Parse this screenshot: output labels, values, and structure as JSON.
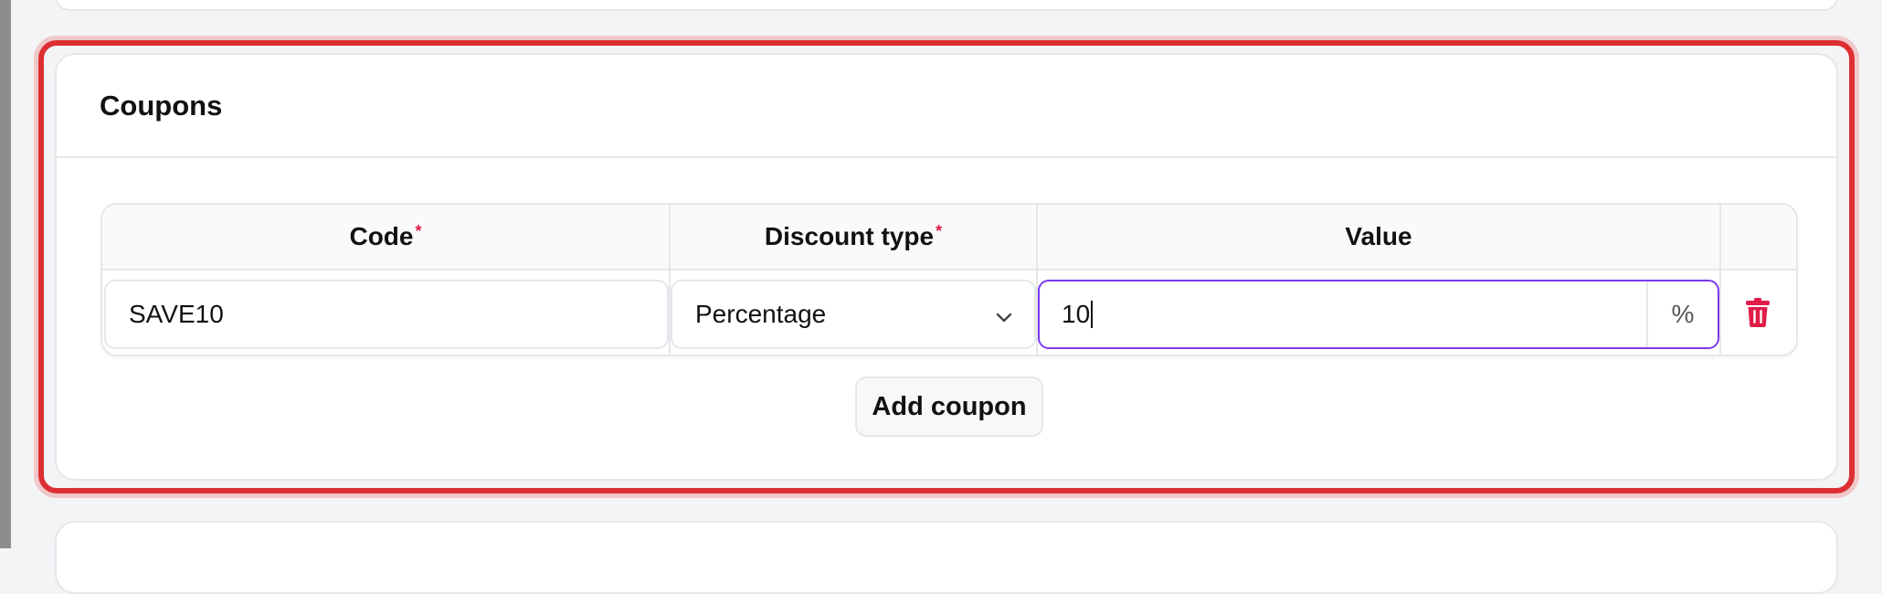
{
  "section": {
    "title": "Coupons"
  },
  "table": {
    "columns": [
      {
        "label": "Code",
        "required": "*"
      },
      {
        "label": "Discount type",
        "required": "*"
      },
      {
        "label": "Value",
        "required": ""
      }
    ],
    "row": {
      "code": "SAVE10",
      "discount_type": "Percentage",
      "value": "10",
      "value_suffix": "%"
    }
  },
  "actions": {
    "add_label": "Add coupon"
  },
  "colors": {
    "highlight": "#dc2f33",
    "focus": "#7c3aed",
    "danger": "#e11d48",
    "required": "#e11d48"
  },
  "icons": {
    "select_chevron": "chevron-down-icon",
    "delete": "trash-icon"
  }
}
